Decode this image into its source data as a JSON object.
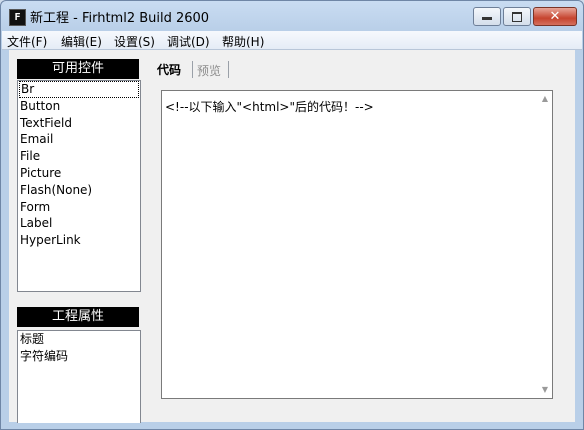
{
  "window": {
    "icon_letter": "F",
    "title": "新工程 - Firhtml2 Build 2600",
    "close_glyph": "✕"
  },
  "menu": [
    "文件(F)",
    "编辑(E)",
    "设置(S)",
    "调试(D)",
    "帮助(H)"
  ],
  "controls_panel": {
    "title": "可用控件",
    "items": [
      "Br",
      "Button",
      "TextField",
      "Email",
      "File",
      "Picture",
      "Flash(None)",
      "Form",
      "Label",
      "HyperLink"
    ],
    "selected_index": 0
  },
  "properties_panel": {
    "title": "工程属性",
    "items": [
      "标题",
      "字符编码"
    ]
  },
  "tabs": [
    {
      "label": "代码",
      "active": true
    },
    {
      "label": "预览",
      "active": false
    }
  ],
  "editor": {
    "content": "<!--以下输入\"<html>\"后的代码！-->",
    "scroll_up": "▲",
    "scroll_down": "▼"
  }
}
